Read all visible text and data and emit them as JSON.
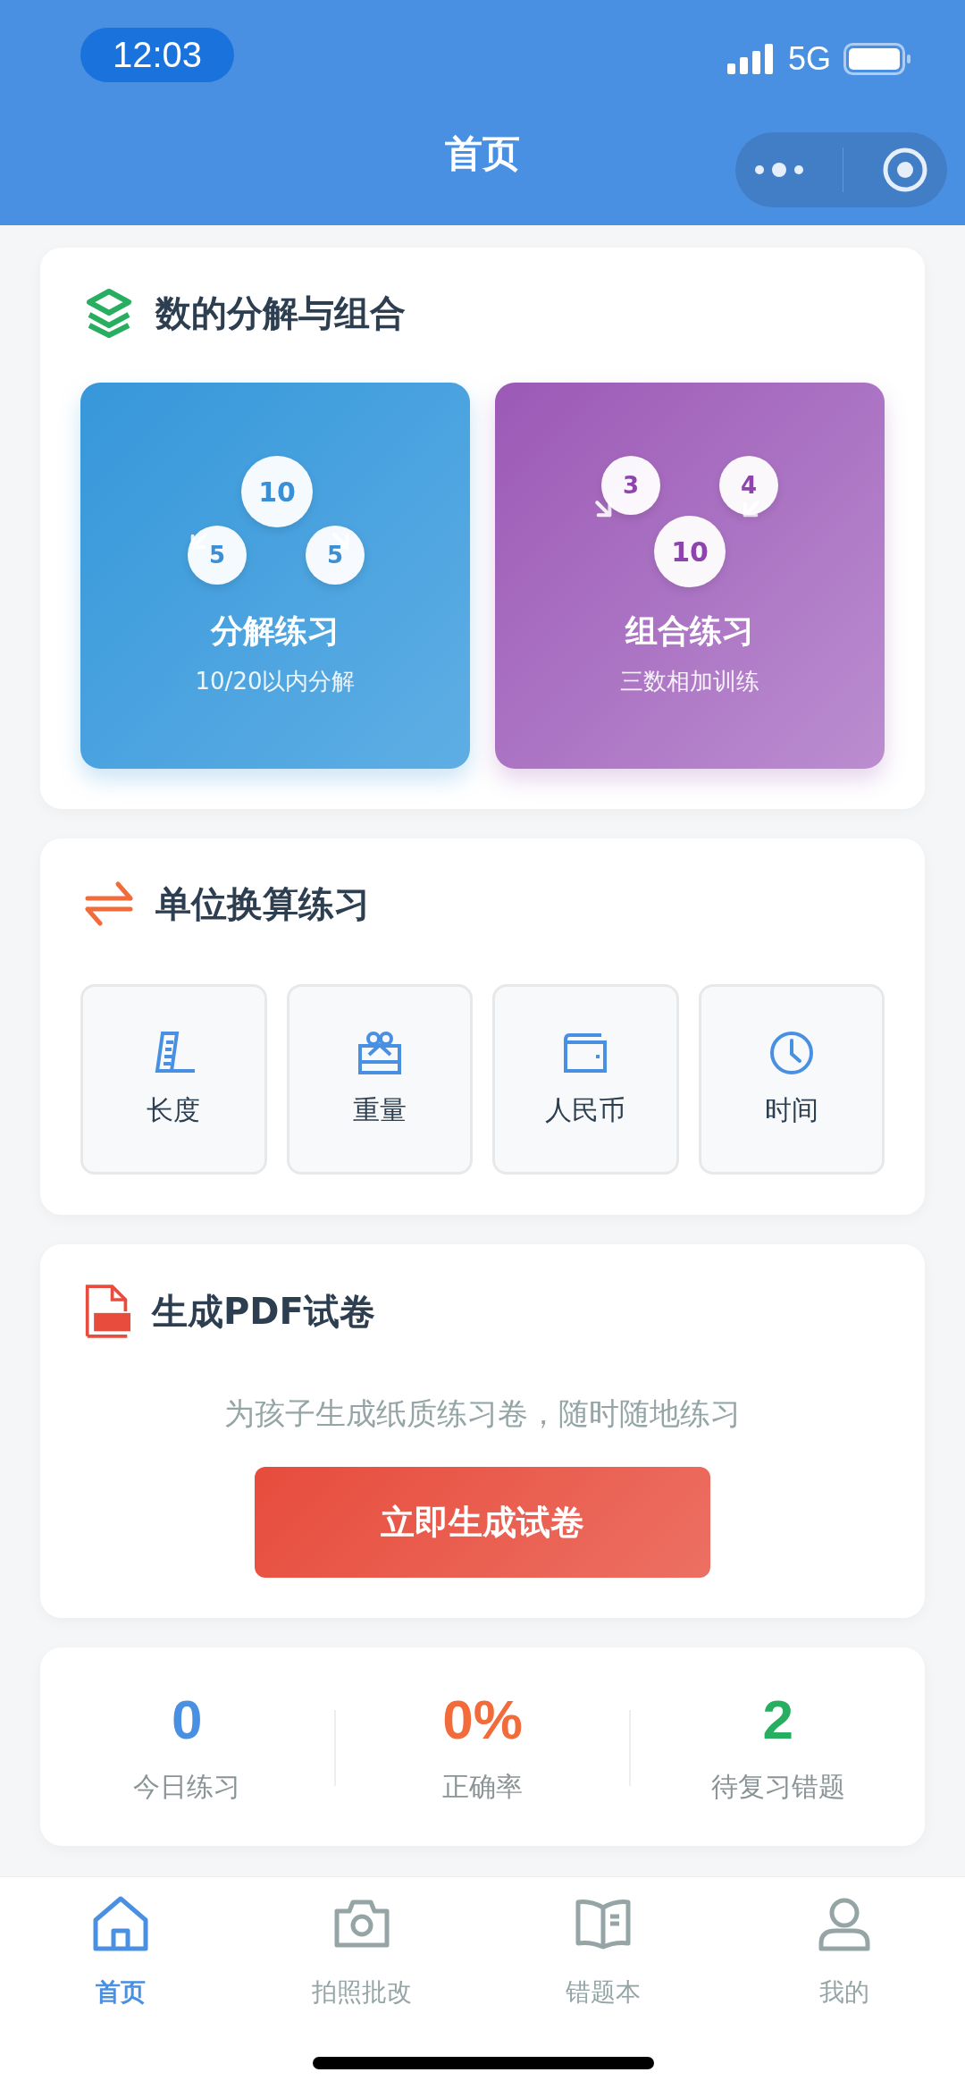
{
  "status_bar": {
    "time": "12:03",
    "network": "5G"
  },
  "nav_bar": {
    "title": "首页"
  },
  "decompose_section": {
    "title": "数的分解与组合",
    "cards": [
      {
        "kind": "decompose",
        "numbers": [
          "10",
          "5",
          "5"
        ],
        "title": "分解练习",
        "subtitle": "10/20以内分解"
      },
      {
        "kind": "combine",
        "numbers": [
          "3",
          "4",
          "10"
        ],
        "title": "组合练习",
        "subtitle": "三数相加训练"
      }
    ]
  },
  "unit_section": {
    "title": "单位换算练习",
    "items": [
      {
        "kind": "length",
        "label": "长度"
      },
      {
        "kind": "weight",
        "label": "重量"
      },
      {
        "kind": "money",
        "label": "人民币"
      },
      {
        "kind": "time",
        "label": "时间"
      }
    ]
  },
  "pdf_section": {
    "title": "生成PDF试卷",
    "description": "为孩子生成纸质练习卷，随时随地练习",
    "button": "立即生成试卷"
  },
  "stats": [
    {
      "value": "0",
      "label": "今日练习",
      "color": "#4a90e2"
    },
    {
      "value": "0%",
      "label": "正确率",
      "color": "#f26b3a"
    },
    {
      "value": "2",
      "label": "待复习错题",
      "color": "#27ae60"
    }
  ],
  "tab_bar": [
    {
      "kind": "home",
      "label": "首页",
      "selected": true
    },
    {
      "kind": "camera",
      "label": "拍照批改",
      "selected": false
    },
    {
      "kind": "book",
      "label": "错题本",
      "selected": false
    },
    {
      "kind": "profile",
      "label": "我的",
      "selected": false
    }
  ]
}
